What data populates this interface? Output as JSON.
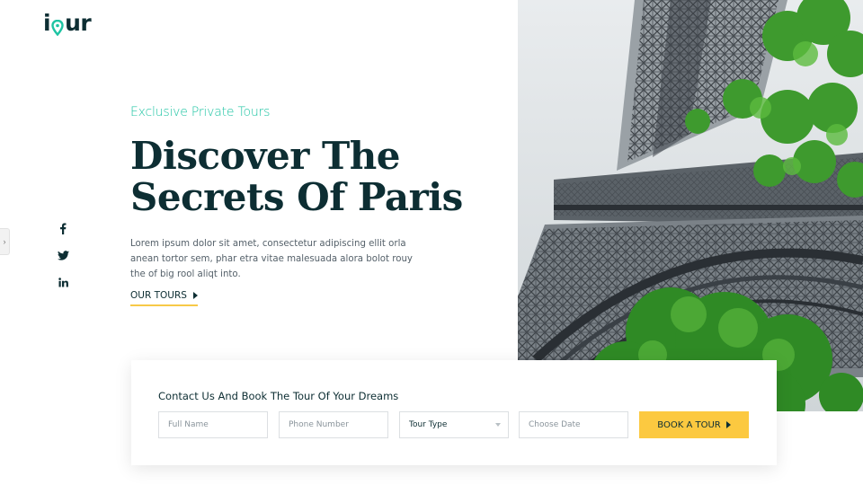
{
  "brand": {
    "logo_prefix": "i",
    "logo_pin": "T",
    "logo_suffix": "ur",
    "accent": "#1ec4a3",
    "dark": "#0d2e33",
    "yellow": "#fcc940"
  },
  "nav": {
    "menu_icon": "hamburger-icon",
    "side_tab_icon": "chevron-right-icon",
    "side_tab_glyph": "›"
  },
  "hero": {
    "eyebrow": "Exclusive Private Tours",
    "title_line1": "Discover The",
    "title_line2": "Secrets Of Paris",
    "description": "Lorem ipsum dolor sit amet, consectetur adipiscing ellit orla anean tortor sem, phar etra vitae malesuada alora bolot rouy the of big rool aliqt into.",
    "cta_label": "OUR TOURS"
  },
  "social": [
    {
      "name": "facebook-icon",
      "glyph": "f"
    },
    {
      "name": "twitter-icon",
      "glyph": "🐦"
    },
    {
      "name": "linkedin-icon",
      "glyph": "in"
    }
  ],
  "booking": {
    "title": "Contact Us And Book The Tour Of Your Dreams",
    "full_name_placeholder": "Full Name",
    "phone_placeholder": "Phone Number",
    "tour_type_label": "Tour Type",
    "date_placeholder": "Choose Date",
    "submit_label": "BOOK A TOUR"
  }
}
